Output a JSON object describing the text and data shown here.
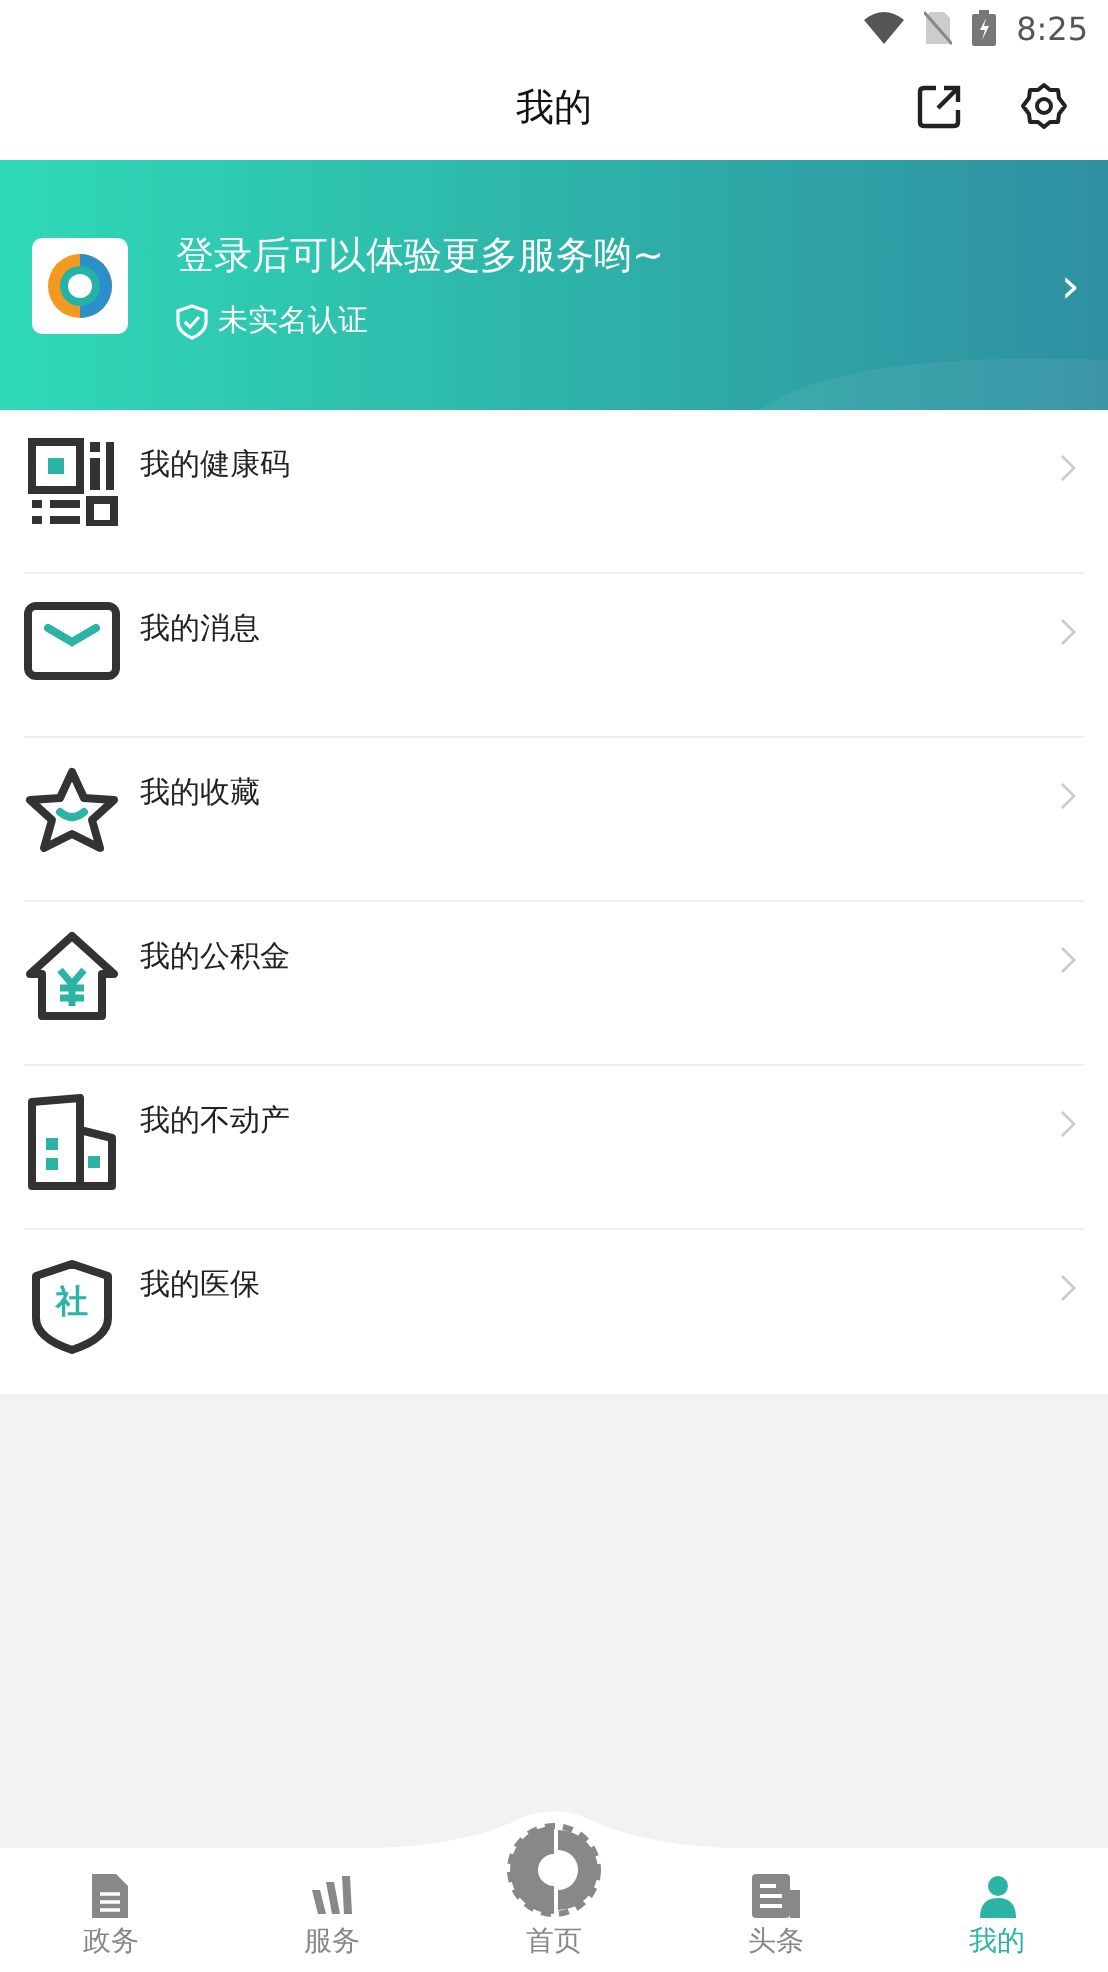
{
  "status_bar": {
    "time": "8:25"
  },
  "header": {
    "title": "我的"
  },
  "banner": {
    "title": "登录后可以体验更多服务哟~",
    "status": "未实名认证",
    "chevron": "›"
  },
  "menu": [
    {
      "kind": "qr",
      "label": "我的健康码"
    },
    {
      "kind": "mail",
      "label": "我的消息"
    },
    {
      "kind": "star",
      "label": "我的收藏"
    },
    {
      "kind": "house",
      "label": "我的公积金"
    },
    {
      "kind": "building",
      "label": "我的不动产"
    },
    {
      "kind": "shield",
      "label": "我的医保",
      "badge": "社"
    }
  ],
  "tabs": [
    {
      "kind": "doc",
      "label": "政务",
      "selected": false
    },
    {
      "kind": "service",
      "label": "服务",
      "selected": false
    },
    {
      "kind": "home",
      "label": "首页",
      "selected": false
    },
    {
      "kind": "news",
      "label": "头条",
      "selected": false
    },
    {
      "kind": "person",
      "label": "我的",
      "selected": true
    }
  ]
}
